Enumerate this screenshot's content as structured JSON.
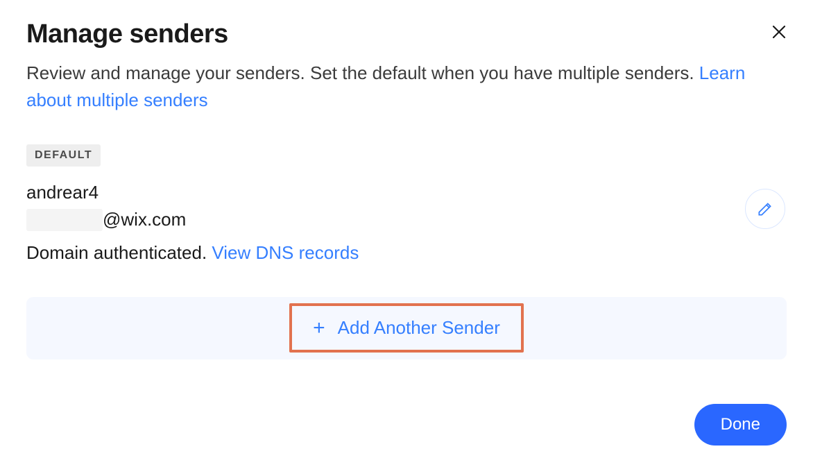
{
  "dialog": {
    "title": "Manage senders",
    "subtitle_text": "Review and manage your senders. Set the default when you have multiple senders. ",
    "subtitle_link": "Learn about multiple senders"
  },
  "badge": {
    "default_label": "DEFAULT"
  },
  "sender": {
    "name": "andrear4",
    "email_domain": "@wix.com",
    "auth_status": "Domain authenticated. ",
    "dns_link": "View DNS records"
  },
  "actions": {
    "add_sender_label": "Add Another Sender",
    "done_label": "Done"
  }
}
